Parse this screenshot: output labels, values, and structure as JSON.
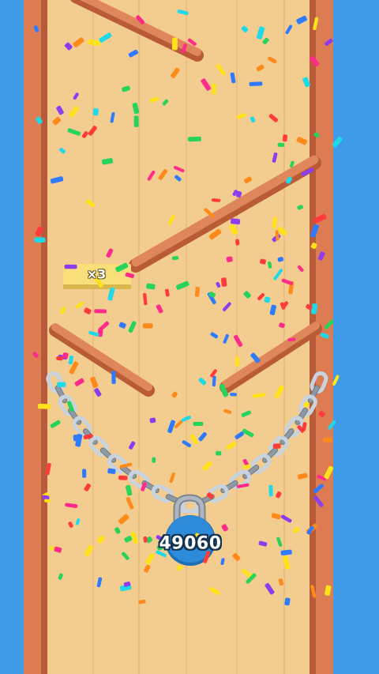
{
  "colors": {
    "sky": "#3f9ae8",
    "board": "#f3cd8f",
    "rail": "#dd7b52",
    "chain": "#c9d3dd",
    "lock_body": "#2d8bd9",
    "lock_shackle": "#9aa3ad"
  },
  "lock": {
    "counter": "49060",
    "icon": "padlock-icon"
  },
  "multiplier_pad": {
    "label": "×3"
  },
  "confetti_colors": [
    "#ff2b8a",
    "#8d3cf0",
    "#2f7bff",
    "#27d35a",
    "#ff8a1c",
    "#ffe21a",
    "#20d9e8",
    "#ff3b3b"
  ]
}
